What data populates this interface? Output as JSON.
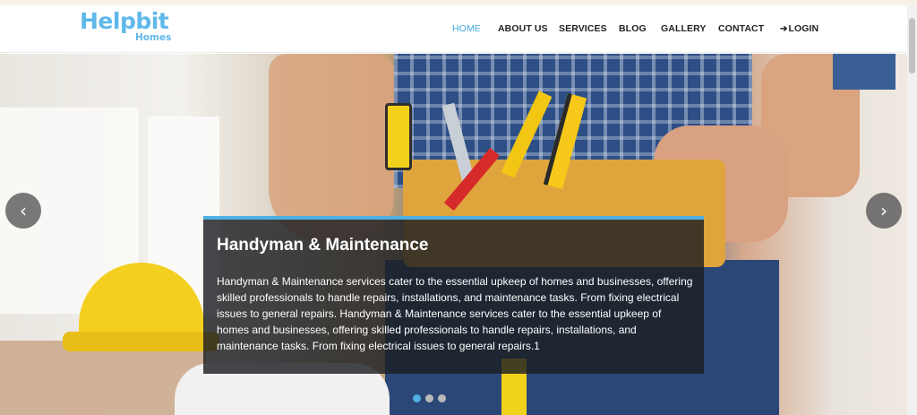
{
  "logo": {
    "main": "Helpbit",
    "sub": "Homes"
  },
  "nav": {
    "home": "HOME",
    "about": "ABOUT US",
    "services": "SERVICES",
    "blog": "BLOG",
    "gallery": "GALLERY",
    "contact": "CONTACT",
    "login": "LOGIN"
  },
  "slider": {
    "prev_icon": "‹",
    "next_icon": "›",
    "caption_title": "Handyman & Maintenance",
    "caption_text": "Handyman & Maintenance services cater to the essential upkeep of homes and businesses, offering skilled professionals to handle repairs, installations, and maintenance tasks. From fixing electrical issues to general repairs. Handyman & Maintenance services cater to the essential upkeep of homes and businesses, offering skilled professionals to handle repairs, installations, and maintenance tasks. From fixing electrical issues to general repairs.1",
    "total_slides": 3,
    "active_slide": 1
  },
  "colors": {
    "accent": "#4fb0e3",
    "logo": "#5fb8ea",
    "caption_bg": "#1c1e22"
  },
  "icons": {
    "login": "sign-in-icon",
    "prev": "chevron-left-icon",
    "next": "chevron-right-icon"
  }
}
